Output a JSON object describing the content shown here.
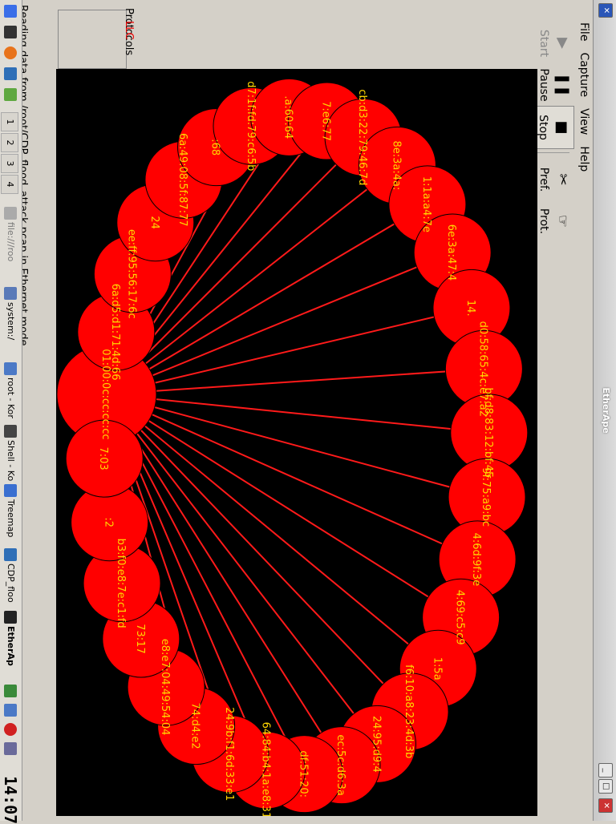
{
  "window": {
    "title": "EtherApe"
  },
  "menubar": {
    "items": [
      "File",
      "Capture",
      "View",
      "Help"
    ]
  },
  "toolbar": {
    "start": "Start",
    "pause": "Pause",
    "stop": "Stop",
    "pref": "Pref.",
    "prot": "Prot."
  },
  "protocols": {
    "label": "Protocols",
    "items": [
      "LLC"
    ]
  },
  "status": {
    "text": "Reading data from /root/CDP_flood_attack.pcap in Ethernet mode"
  },
  "taskbar": {
    "desktops": [
      "1",
      "2",
      "3",
      "4"
    ],
    "tasks": [
      "file:///roo",
      "system:/",
      "root - Kor",
      "Shell - Ko",
      "Treemap",
      "CDP_floo",
      "EtherAp"
    ],
    "clock": "14:07"
  },
  "graph": {
    "node_color": "#ff0000",
    "label_color": "#ffd700",
    "link_color": "#ff1a1a",
    "hub": "01:00:0c:cc:cc:cc",
    "nodes": [
      "6a:d5:d1:71:4d:66",
      "ee:ff:95:56:17:6c",
      "24",
      "6a:49:08:5f:87:77",
      ":68",
      "d7:1f:fd:79:c6:5b",
      ".a:60:64",
      "7:e6:77",
      "cb:d3:22:79:46:7d",
      "8e:3a:4a:",
      "1:1a:a4:7e",
      "6e:3a:47:4",
      "14.",
      "d0:58:65:4c:e7:a2",
      "bf:d8:83:12:bf:45",
      "9f:75:a9:bc",
      "4:6d:9f:3e",
      "4:69:c5:c9",
      "1:5a",
      "f6:10:a8:23:4d:3b",
      "24:95:d9:4",
      "ec:5c:d6:3a",
      "df:51:20:",
      "64:84:b4:1a:e8:31",
      "24:9b:f1:6d:33:e1",
      "74:d4:e2",
      "e8:e7:04:49:54:04",
      "73:17",
      "b3:f0:e8:7e:c1:fd",
      ":2",
      "7:03"
    ]
  }
}
